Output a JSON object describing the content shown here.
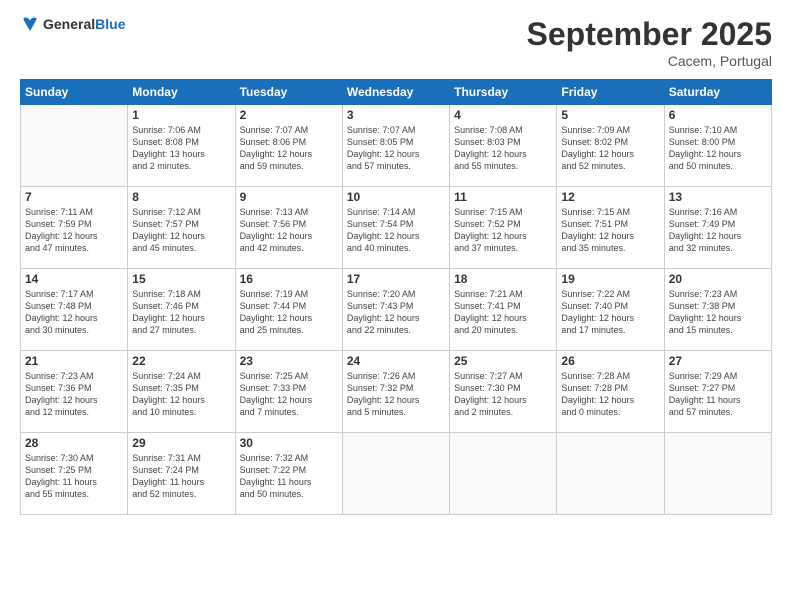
{
  "logo": {
    "general": "General",
    "blue": "Blue"
  },
  "title": "September 2025",
  "location": "Cacem, Portugal",
  "days_header": [
    "Sunday",
    "Monday",
    "Tuesday",
    "Wednesday",
    "Thursday",
    "Friday",
    "Saturday"
  ],
  "weeks": [
    [
      {
        "day": "",
        "info": ""
      },
      {
        "day": "1",
        "info": "Sunrise: 7:06 AM\nSunset: 8:08 PM\nDaylight: 13 hours\nand 2 minutes."
      },
      {
        "day": "2",
        "info": "Sunrise: 7:07 AM\nSunset: 8:06 PM\nDaylight: 12 hours\nand 59 minutes."
      },
      {
        "day": "3",
        "info": "Sunrise: 7:07 AM\nSunset: 8:05 PM\nDaylight: 12 hours\nand 57 minutes."
      },
      {
        "day": "4",
        "info": "Sunrise: 7:08 AM\nSunset: 8:03 PM\nDaylight: 12 hours\nand 55 minutes."
      },
      {
        "day": "5",
        "info": "Sunrise: 7:09 AM\nSunset: 8:02 PM\nDaylight: 12 hours\nand 52 minutes."
      },
      {
        "day": "6",
        "info": "Sunrise: 7:10 AM\nSunset: 8:00 PM\nDaylight: 12 hours\nand 50 minutes."
      }
    ],
    [
      {
        "day": "7",
        "info": "Sunrise: 7:11 AM\nSunset: 7:59 PM\nDaylight: 12 hours\nand 47 minutes."
      },
      {
        "day": "8",
        "info": "Sunrise: 7:12 AM\nSunset: 7:57 PM\nDaylight: 12 hours\nand 45 minutes."
      },
      {
        "day": "9",
        "info": "Sunrise: 7:13 AM\nSunset: 7:56 PM\nDaylight: 12 hours\nand 42 minutes."
      },
      {
        "day": "10",
        "info": "Sunrise: 7:14 AM\nSunset: 7:54 PM\nDaylight: 12 hours\nand 40 minutes."
      },
      {
        "day": "11",
        "info": "Sunrise: 7:15 AM\nSunset: 7:52 PM\nDaylight: 12 hours\nand 37 minutes."
      },
      {
        "day": "12",
        "info": "Sunrise: 7:15 AM\nSunset: 7:51 PM\nDaylight: 12 hours\nand 35 minutes."
      },
      {
        "day": "13",
        "info": "Sunrise: 7:16 AM\nSunset: 7:49 PM\nDaylight: 12 hours\nand 32 minutes."
      }
    ],
    [
      {
        "day": "14",
        "info": "Sunrise: 7:17 AM\nSunset: 7:48 PM\nDaylight: 12 hours\nand 30 minutes."
      },
      {
        "day": "15",
        "info": "Sunrise: 7:18 AM\nSunset: 7:46 PM\nDaylight: 12 hours\nand 27 minutes."
      },
      {
        "day": "16",
        "info": "Sunrise: 7:19 AM\nSunset: 7:44 PM\nDaylight: 12 hours\nand 25 minutes."
      },
      {
        "day": "17",
        "info": "Sunrise: 7:20 AM\nSunset: 7:43 PM\nDaylight: 12 hours\nand 22 minutes."
      },
      {
        "day": "18",
        "info": "Sunrise: 7:21 AM\nSunset: 7:41 PM\nDaylight: 12 hours\nand 20 minutes."
      },
      {
        "day": "19",
        "info": "Sunrise: 7:22 AM\nSunset: 7:40 PM\nDaylight: 12 hours\nand 17 minutes."
      },
      {
        "day": "20",
        "info": "Sunrise: 7:23 AM\nSunset: 7:38 PM\nDaylight: 12 hours\nand 15 minutes."
      }
    ],
    [
      {
        "day": "21",
        "info": "Sunrise: 7:23 AM\nSunset: 7:36 PM\nDaylight: 12 hours\nand 12 minutes."
      },
      {
        "day": "22",
        "info": "Sunrise: 7:24 AM\nSunset: 7:35 PM\nDaylight: 12 hours\nand 10 minutes."
      },
      {
        "day": "23",
        "info": "Sunrise: 7:25 AM\nSunset: 7:33 PM\nDaylight: 12 hours\nand 7 minutes."
      },
      {
        "day": "24",
        "info": "Sunrise: 7:26 AM\nSunset: 7:32 PM\nDaylight: 12 hours\nand 5 minutes."
      },
      {
        "day": "25",
        "info": "Sunrise: 7:27 AM\nSunset: 7:30 PM\nDaylight: 12 hours\nand 2 minutes."
      },
      {
        "day": "26",
        "info": "Sunrise: 7:28 AM\nSunset: 7:28 PM\nDaylight: 12 hours\nand 0 minutes."
      },
      {
        "day": "27",
        "info": "Sunrise: 7:29 AM\nSunset: 7:27 PM\nDaylight: 11 hours\nand 57 minutes."
      }
    ],
    [
      {
        "day": "28",
        "info": "Sunrise: 7:30 AM\nSunset: 7:25 PM\nDaylight: 11 hours\nand 55 minutes."
      },
      {
        "day": "29",
        "info": "Sunrise: 7:31 AM\nSunset: 7:24 PM\nDaylight: 11 hours\nand 52 minutes."
      },
      {
        "day": "30",
        "info": "Sunrise: 7:32 AM\nSunset: 7:22 PM\nDaylight: 11 hours\nand 50 minutes."
      },
      {
        "day": "",
        "info": ""
      },
      {
        "day": "",
        "info": ""
      },
      {
        "day": "",
        "info": ""
      },
      {
        "day": "",
        "info": ""
      }
    ]
  ]
}
